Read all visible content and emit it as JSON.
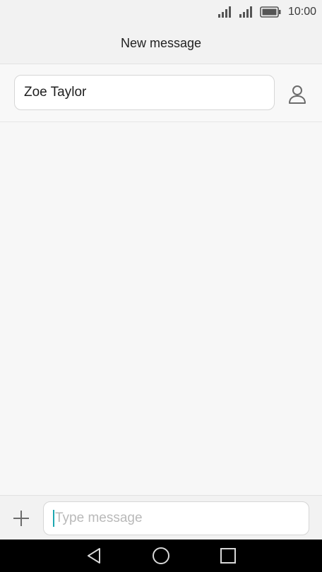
{
  "status_bar": {
    "time": "10:00",
    "icons": [
      "signal-icon",
      "signal-icon",
      "battery-icon"
    ]
  },
  "header": {
    "title": "New message"
  },
  "recipient": {
    "value": "Zoe Taylor",
    "contact_icon": "person-icon"
  },
  "compose": {
    "attach_icon": "plus-icon",
    "placeholder": "Type message",
    "value": ""
  },
  "nav": {
    "icons": [
      "back-icon",
      "home-icon",
      "recents-icon"
    ]
  },
  "colors": {
    "accent": "#1ca7b0",
    "background": "#f6f6f6",
    "nav_bar": "#000000"
  }
}
